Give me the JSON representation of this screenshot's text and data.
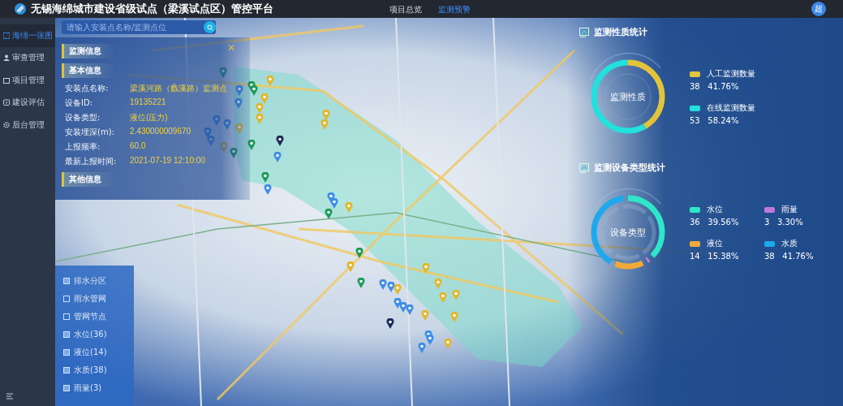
{
  "header": {
    "title": "无锡海绵城市建设省级试点（梁溪试点区）管控平台",
    "avatar": "超",
    "nav": [
      {
        "label": "项目总览",
        "selected": false
      },
      {
        "label": "监测预警",
        "selected": true
      }
    ]
  },
  "sidebar": {
    "items": [
      {
        "label": "海绵一张图",
        "kind": "map",
        "selected": true
      },
      {
        "label": "审查管理",
        "kind": "user",
        "selected": false
      },
      {
        "label": "项目管理",
        "kind": "folder",
        "selected": false
      },
      {
        "label": "建设评估",
        "kind": "clipboard",
        "selected": false
      },
      {
        "label": "后台管理",
        "kind": "gear",
        "selected": false
      }
    ]
  },
  "search": {
    "placeholder": "请输入安装点名称/监测点位"
  },
  "info_panel": {
    "title": "监测信息",
    "sections": [
      {
        "title": "基本信息",
        "fields": [
          {
            "label": "安装点名称:",
            "value": "梁溪河路（蠡溪路）监测点"
          },
          {
            "label": "设备ID:",
            "value": "19135221"
          },
          {
            "label": "设备类型:",
            "value": "液位(压力)"
          },
          {
            "label": "安装埋深(m):",
            "value": "2.430000009670"
          },
          {
            "label": "上报频率:",
            "value": "60.0"
          },
          {
            "label": "最新上报时间:",
            "value": "2021-07-19 12:10:00"
          }
        ]
      },
      {
        "title": "其他信息"
      }
    ],
    "close_glyph": "✕"
  },
  "layers": [
    {
      "label": "排水分区",
      "checked": true
    },
    {
      "label": "雨水管网",
      "checked": false
    },
    {
      "label": "管网节点",
      "checked": false
    },
    {
      "label": "水位(36)",
      "checked": true
    },
    {
      "label": "液位(14)",
      "checked": true
    },
    {
      "label": "水质(38)",
      "checked": true
    },
    {
      "label": "雨量(3)",
      "checked": true
    }
  ],
  "stats": [
    {
      "title": "监测性质统计",
      "center_label": "监测性质",
      "legend": [
        {
          "name": "人工监测数量",
          "count": "38",
          "percent": "41.76%",
          "color": "#e2c33a"
        },
        {
          "name": "在线监测数量",
          "count": "53",
          "percent": "58.24%",
          "color": "#22e0dc"
        }
      ]
    },
    {
      "title": "监测设备类型统计",
      "center_label": "设备类型",
      "legend": [
        {
          "name": "水位",
          "count": "36",
          "percent": "39.56%",
          "color": "#2ee6c8"
        },
        {
          "name": "雨量",
          "count": "3",
          "percent": "3.30%",
          "color": "#c07ad8"
        },
        {
          "name": "液位",
          "count": "14",
          "percent": "15.38%",
          "color": "#f2a93a"
        },
        {
          "name": "水质",
          "count": "38",
          "percent": "41.76%",
          "color": "#1fa8ec"
        }
      ]
    }
  ]
}
